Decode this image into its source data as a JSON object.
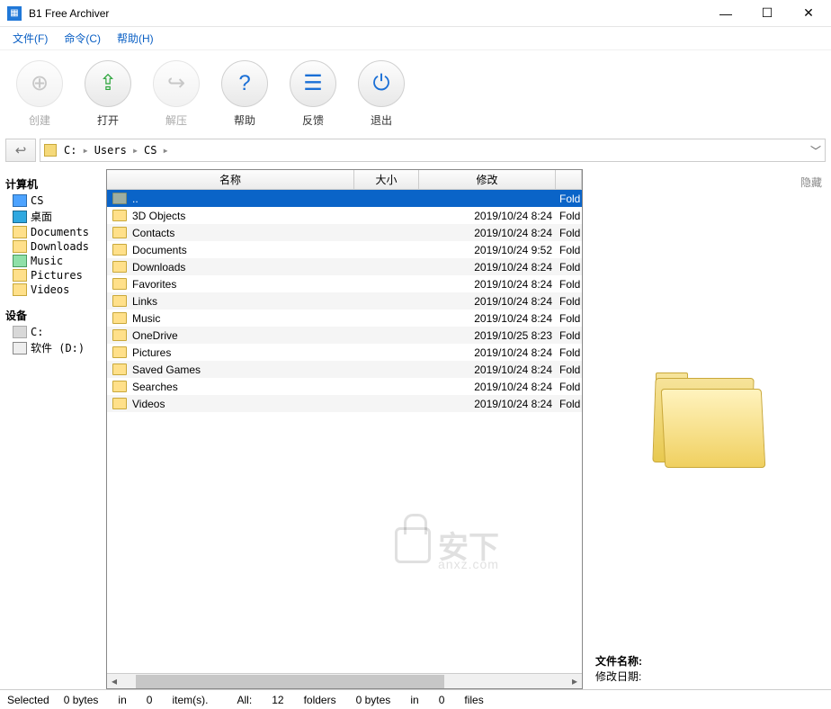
{
  "window": {
    "title": "B1 Free Archiver"
  },
  "menubar": [
    {
      "label": "文件(F)"
    },
    {
      "label": "命令(C)"
    },
    {
      "label": "帮助(H)"
    }
  ],
  "toolbar": [
    {
      "id": "create",
      "label": "创建",
      "glyph": "⊕",
      "color": "#9a9a9a",
      "disabled": true
    },
    {
      "id": "open",
      "label": "打开",
      "glyph": "⇪",
      "color": "#2aa43a",
      "disabled": false
    },
    {
      "id": "extract",
      "label": "解压",
      "glyph": "↪",
      "color": "#9a9a9a",
      "disabled": true
    },
    {
      "id": "help",
      "label": "帮助",
      "glyph": "?",
      "color": "#1a6fd6",
      "disabled": false
    },
    {
      "id": "feedback",
      "label": "反馈",
      "glyph": "☰",
      "color": "#1a6fd6",
      "disabled": false
    },
    {
      "id": "exit",
      "label": "退出",
      "glyph": "⏻",
      "color": "#1a6fd6",
      "disabled": false
    }
  ],
  "path": {
    "drive": "C:",
    "segments": [
      "Users",
      "CS"
    ]
  },
  "sidebar": {
    "computer_label": "计算机",
    "computer_items": [
      {
        "icon": "user",
        "label": "CS"
      },
      {
        "icon": "desktop",
        "label": "桌面"
      },
      {
        "icon": "folder",
        "label": "Documents"
      },
      {
        "icon": "folder",
        "label": "Downloads"
      },
      {
        "icon": "music",
        "label": "Music"
      },
      {
        "icon": "folder",
        "label": "Pictures"
      },
      {
        "icon": "folder",
        "label": "Videos"
      }
    ],
    "devices_label": "设备",
    "device_items": [
      {
        "icon": "drive",
        "label": "C:"
      },
      {
        "icon": "disk",
        "label": "软件 (D:)"
      }
    ]
  },
  "columns": {
    "name": "名称",
    "size": "大小",
    "modified": "修改"
  },
  "rows": [
    {
      "name": "..",
      "size": "",
      "modified": "",
      "type": "Fold",
      "selected": true,
      "up": true
    },
    {
      "name": "3D Objects",
      "size": "",
      "modified": "2019/10/24 8:24",
      "type": "Fold"
    },
    {
      "name": "Contacts",
      "size": "",
      "modified": "2019/10/24 8:24",
      "type": "Fold"
    },
    {
      "name": "Documents",
      "size": "",
      "modified": "2019/10/24 9:52",
      "type": "Fold"
    },
    {
      "name": "Downloads",
      "size": "",
      "modified": "2019/10/24 8:24",
      "type": "Fold"
    },
    {
      "name": "Favorites",
      "size": "",
      "modified": "2019/10/24 8:24",
      "type": "Fold"
    },
    {
      "name": "Links",
      "size": "",
      "modified": "2019/10/24 8:24",
      "type": "Fold"
    },
    {
      "name": "Music",
      "size": "",
      "modified": "2019/10/24 8:24",
      "type": "Fold"
    },
    {
      "name": "OneDrive",
      "size": "",
      "modified": "2019/10/25 8:23",
      "type": "Fold"
    },
    {
      "name": "Pictures",
      "size": "",
      "modified": "2019/10/24 8:24",
      "type": "Fold"
    },
    {
      "name": "Saved Games",
      "size": "",
      "modified": "2019/10/24 8:24",
      "type": "Fold"
    },
    {
      "name": "Searches",
      "size": "",
      "modified": "2019/10/24 8:24",
      "type": "Fold"
    },
    {
      "name": "Videos",
      "size": "",
      "modified": "2019/10/24 8:24",
      "type": "Fold"
    }
  ],
  "preview": {
    "hide_label": "隐藏",
    "filename_label": "文件名称:",
    "modified_label": "修改日期:",
    "filename_value": "",
    "modified_value": ""
  },
  "statusbar": {
    "selected_label": "Selected",
    "selected_bytes": "0 bytes",
    "in1": "in",
    "selected_items_n": "0",
    "items_label": "item(s).",
    "all_label": "All:",
    "folders_n": "12",
    "folders_label": "folders",
    "all_bytes": "0 bytes",
    "in2": "in",
    "files_n": "0",
    "files_label": "files"
  },
  "watermark": {
    "main": "安下",
    "sub": "anxz.com"
  }
}
